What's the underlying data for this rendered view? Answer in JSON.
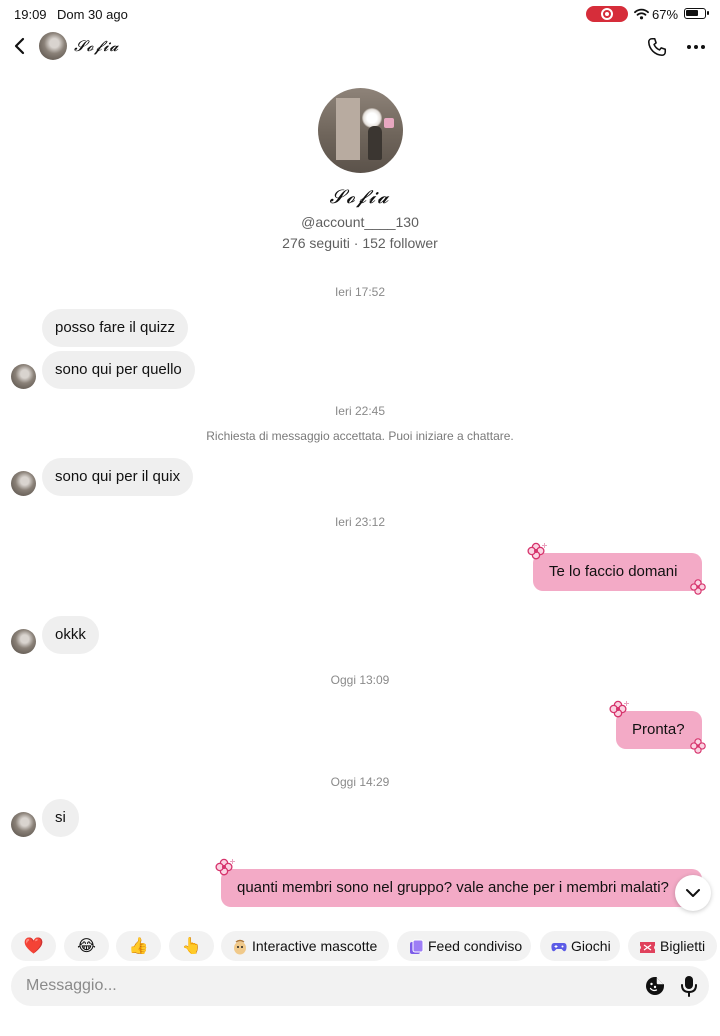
{
  "status_bar": {
    "time": "19:09",
    "date": "Dom 30 ago",
    "battery": "67%"
  },
  "header": {
    "contact_name": "𝓢𝓸𝓯𝓲𝓪"
  },
  "profile": {
    "name": "𝓢𝓸𝓯𝓲𝓪",
    "username": "@account____130",
    "stats": "276 seguiti · 152 follower"
  },
  "messages": {
    "ts1": "Ieri 17:52",
    "m1": "posso fare il quizz",
    "m2": "sono qui per quello",
    "ts2": "Ieri 22:45",
    "system1": "Richiesta di messaggio accettata. Puoi iniziare a chattare.",
    "m3": "sono qui per il quix",
    "ts3": "Ieri 23:12",
    "m4": "Te lo faccio domani",
    "m5": "okkk",
    "ts4": "Oggi 13:09",
    "m6": "Pronta?",
    "ts5": "Oggi 14:29",
    "m7": "si",
    "m8": "quanti membri sono nel gruppo? vale anche per i membri malati?"
  },
  "quick_actions": {
    "heart": "❤️",
    "laugh": "😂",
    "thumbs_up": "👍",
    "point": "👆",
    "mascotte": "Interactive mascotte",
    "feed": "Feed condiviso",
    "giochi": "Giochi",
    "biglietti": "Biglietti"
  },
  "composer": {
    "placeholder": "Messaggio..."
  },
  "colors": {
    "outgoing_bubble": "#f3aac6",
    "incoming_bubble": "#efefef",
    "record_pill": "#d62d3a",
    "flower": "#d6336c"
  },
  "icons": [
    "back-icon",
    "phone-icon",
    "more-icon",
    "flower-icon",
    "chevron-down-icon",
    "sticker-icon",
    "mic-icon",
    "wifi-icon",
    "battery-icon"
  ]
}
